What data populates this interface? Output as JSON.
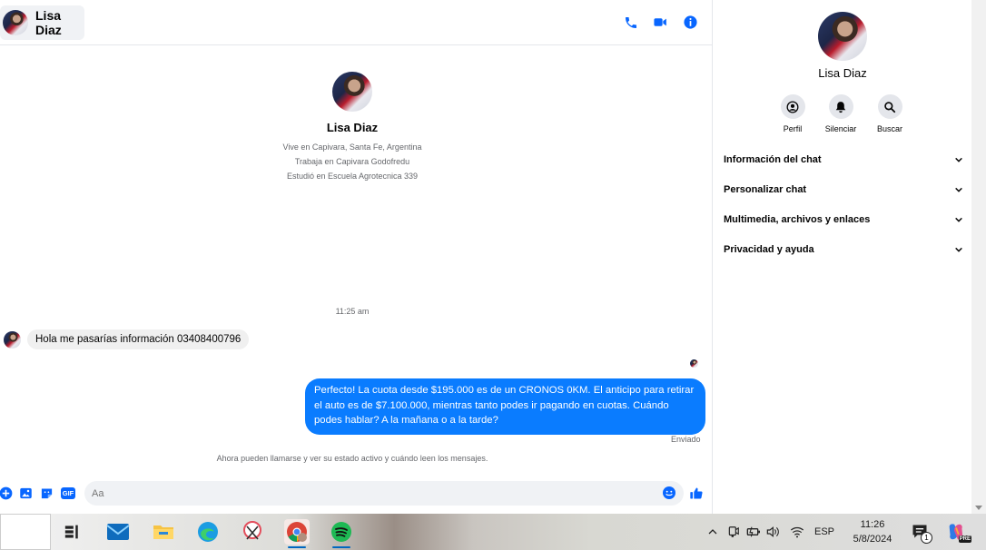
{
  "header": {
    "contact_name": "Lisa Diaz",
    "icons": [
      "phone-icon",
      "video-icon",
      "info-icon"
    ]
  },
  "profile": {
    "name": "Lisa Diaz",
    "lives": "Vive en Capivara, Santa Fe, Argentina",
    "works": "Trabaja en Capivara Godofredu",
    "studied": "Estudió en Escuela Agrotecnica 339"
  },
  "conversation": {
    "timestamp": "11:25 am",
    "incoming": "Hola me pasarías información 03408400796",
    "outgoing": "Perfecto! La cuota desde $195.000 es de un CRONOS 0KM. El anticipo para retirar el auto es de $7.100.000, mientras tanto podes ir pagando en cuotas. Cuándo podes hablar? A la mañana o a la tarde?",
    "status": "Enviado",
    "notice": "Ahora pueden llamarse y ver su estado activo y cuándo leen los mensajes."
  },
  "composer": {
    "placeholder": "Aa",
    "gif_label": "GIF"
  },
  "side_panel": {
    "name": "Lisa Diaz",
    "actions": [
      {
        "label": "Perfil",
        "icon": "profile-icon"
      },
      {
        "label": "Silenciar",
        "icon": "bell-icon"
      },
      {
        "label": "Buscar",
        "icon": "search-icon"
      }
    ],
    "sections": [
      "Información del chat",
      "Personalizar chat",
      "Multimedia, archivos y enlaces",
      "Privacidad y ayuda"
    ]
  },
  "taskbar": {
    "language": "ESP",
    "time": "11:26",
    "date": "5/8/2024",
    "notification_count": "1",
    "copilot_badge": "PRE"
  },
  "colors": {
    "accent": "#0a7cff",
    "icon_blue": "#0866ff"
  }
}
